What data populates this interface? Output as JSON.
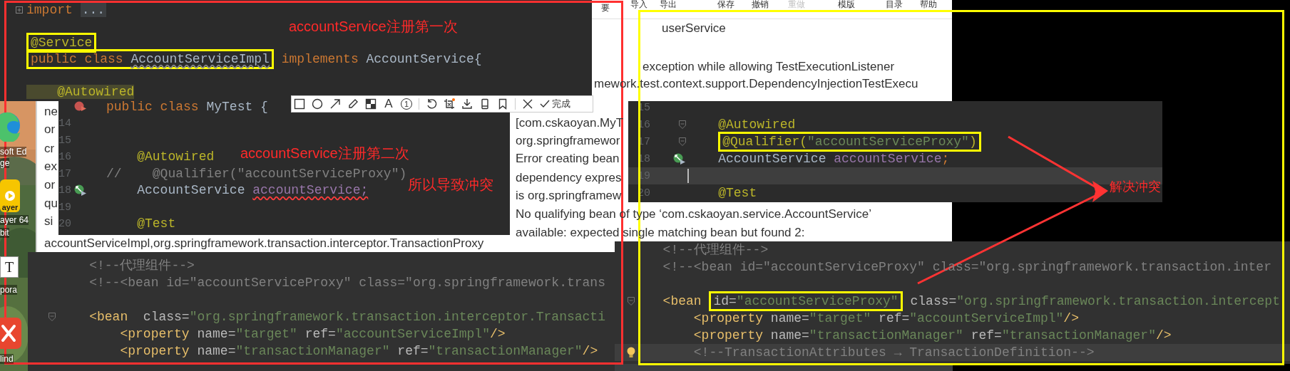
{
  "desktop": {
    "icons": [
      {
        "kind": "edge",
        "labels": [
          "soft Ed",
          "ge"
        ]
      },
      {
        "kind": "player",
        "badge": "ayer",
        "labels": [
          "ayer 64",
          "bit"
        ]
      },
      {
        "kind": "typora",
        "badge": "T",
        "labels": [
          "pora"
        ]
      },
      {
        "kind": "xmind",
        "labels": [
          "lind"
        ]
      }
    ]
  },
  "document": {
    "menu": [
      {
        "label": "要",
        "disabled": false
      },
      {
        "label": "导入",
        "disabled": false
      },
      {
        "label": "导出",
        "disabled": false
      },
      {
        "label": "保存",
        "disabled": false
      },
      {
        "label": "撤销",
        "disabled": false
      },
      {
        "label": "重做",
        "disabled": true
      },
      {
        "label": "模版",
        "disabled": false
      },
      {
        "label": "目录",
        "disabled": false
      },
      {
        "label": "帮助",
        "disabled": false
      }
    ],
    "texts": [
      "userService",
      "exception while allowing TestExecutionListener",
      "mework.test.context.support.DependencyInjectionTestExecu",
      "[com.cskaoyan.MyT",
      "org.springframewor",
      "Error creating bean",
      "dependency expres",
      "is org.springframew",
      "No qualifying bean of type ‘com.cskaoyan.service.AccountService’",
      "available: expected single matching bean but found 2:",
      "ne",
      "or",
      "cr",
      "ex",
      "or",
      "qu",
      "si",
      "accountServiceImpl,org.springframework.transaction.interceptor.TransactionProxy"
    ]
  },
  "toolbar": {
    "text_tool": "A",
    "number_tool": "1",
    "done": "完成"
  },
  "editors": [
    {
      "kind": "java",
      "lines": [
        {
          "kind": "code",
          "gutter": {
            "kind": "fold_plus"
          },
          "segments": [
            {
              "kind": "keyword",
              "text": "import ",
              "boxed": false
            },
            {
              "kind": "folded",
              "text": "...",
              "boxed": false
            }
          ]
        },
        {
          "kind": "blank"
        },
        {
          "kind": "code",
          "segments": [
            {
              "kind": "annotation",
              "text": "@Service",
              "boxed": true
            }
          ]
        },
        {
          "kind": "code",
          "segments": [
            {
              "kind": "keyword",
              "text": "public class ",
              "boxed": true
            },
            {
              "kind": "unused",
              "text": "AccountServiceImpl",
              "boxed": true
            },
            {
              "kind": "keyword",
              "text": " implements ",
              "boxed": false
            },
            {
              "kind": "plain",
              "text": "AccountService{",
              "boxed": false
            }
          ]
        },
        {
          "kind": "blank"
        },
        {
          "kind": "code",
          "segments": [
            {
              "kind": "annotation_usage",
              "text": "    @Autowired",
              "boxed": false
            }
          ]
        }
      ]
    },
    {
      "kind": "java",
      "lines": [
        {
          "kind": "code",
          "gutter": {
            "kind": "run_red"
          },
          "segments": [
            {
              "kind": "keyword",
              "text": "public class ",
              "boxed": false
            },
            {
              "kind": "plain",
              "text": "MyTest {",
              "boxed": false
            }
          ]
        },
        {
          "kind": "blank",
          "number": "14"
        },
        {
          "kind": "blank",
          "number": "15"
        },
        {
          "kind": "code",
          "number": "16",
          "segments": [
            {
              "kind": "annotation",
              "text": "    @Autowired",
              "boxed": false
            }
          ]
        },
        {
          "kind": "code",
          "number": "17",
          "segments": [
            {
              "kind": "comment",
              "text": "//    @Qualifier(\"accountServiceProxy\")",
              "boxed": false
            }
          ]
        },
        {
          "kind": "code",
          "number": "18",
          "gutter": {
            "kind": "run"
          },
          "segments": [
            {
              "kind": "plain",
              "text": "    AccountService ",
              "boxed": false
            },
            {
              "kind": "field_error",
              "text": "accountService;",
              "boxed": false
            }
          ]
        },
        {
          "kind": "blank",
          "number": "19"
        },
        {
          "kind": "code",
          "number": "20",
          "segments": [
            {
              "kind": "annotation",
              "text": "    @Test",
              "boxed": false
            }
          ]
        }
      ]
    },
    {
      "kind": "java",
      "lines": [
        {
          "kind": "blank",
          "number": "15",
          "current": false
        },
        {
          "kind": "code",
          "number": "16",
          "gutter": {
            "kind": "fold"
          },
          "current": false,
          "segments": [
            {
              "kind": "annotation",
              "text": "    @Autowired",
              "boxed": false
            }
          ]
        },
        {
          "kind": "code",
          "number": "17",
          "gutter": {
            "kind": "fold"
          },
          "current": false,
          "segments": [
            {
              "kind": "annotation",
              "text": "    @Qualifier(",
              "boxed": true
            },
            {
              "kind": "string",
              "text": "\"accountServiceProxy\"",
              "boxed": true
            },
            {
              "kind": "annotation",
              "text": ")",
              "boxed": true
            }
          ]
        },
        {
          "kind": "code",
          "number": "18",
          "gutter": {
            "kind": "run"
          },
          "current": false,
          "segments": [
            {
              "kind": "plain",
              "text": "    AccountService ",
              "boxed": false
            },
            {
              "kind": "field",
              "text": "accountService",
              "boxed": false
            },
            {
              "kind": "keyword",
              "text": ";",
              "boxed": false
            }
          ]
        },
        {
          "kind": "blank",
          "number": "19",
          "current": true
        },
        {
          "kind": "code",
          "number": "20",
          "current": false,
          "segments": [
            {
              "kind": "annotation",
              "text": "    @Test",
              "boxed": false
            }
          ]
        }
      ]
    },
    {
      "kind": "xml",
      "lines": [
        {
          "kind": "code",
          "segments": [
            {
              "kind": "comment",
              "text": "    <!--代理组件-->",
              "boxed": false
            }
          ]
        },
        {
          "kind": "code",
          "segments": [
            {
              "kind": "comment",
              "text": "    <!--<bean id=\"accountServiceProxy\" class=\"org.springframework.trans",
              "boxed": false
            }
          ]
        },
        {
          "kind": "blank"
        },
        {
          "kind": "code",
          "gutter": {
            "kind": "fold"
          },
          "segments": [
            {
              "kind": "tag",
              "text": "    <bean",
              "boxed": false
            },
            {
              "kind": "attr",
              "text": "  class=",
              "boxed": false
            },
            {
              "kind": "string",
              "text": "\"org.springframework.transaction.interceptor.Transacti",
              "boxed": false
            }
          ]
        },
        {
          "kind": "code",
          "segments": [
            {
              "kind": "tag",
              "text": "        <property",
              "boxed": false
            },
            {
              "kind": "attr",
              "text": " name=",
              "boxed": false
            },
            {
              "kind": "string",
              "text": "\"target\"",
              "boxed": false
            },
            {
              "kind": "attr",
              "text": " ref=",
              "boxed": false
            },
            {
              "kind": "string",
              "text": "\"accountServiceImpl\"",
              "boxed": false
            },
            {
              "kind": "tag",
              "text": "/>",
              "boxed": false
            }
          ]
        },
        {
          "kind": "code",
          "segments": [
            {
              "kind": "tag",
              "text": "        <property",
              "boxed": false
            },
            {
              "kind": "attr",
              "text": " name=",
              "boxed": false
            },
            {
              "kind": "string",
              "text": "\"transactionManager\"",
              "boxed": false
            },
            {
              "kind": "attr",
              "text": " ref=",
              "boxed": false
            },
            {
              "kind": "string",
              "text": "\"transactionManager\"",
              "boxed": false
            },
            {
              "kind": "tag",
              "text": "/>",
              "boxed": false
            }
          ]
        }
      ]
    },
    {
      "kind": "xml",
      "lines": [
        {
          "kind": "code",
          "current": false,
          "segments": [
            {
              "kind": "comment",
              "text": "  <!--代理组件-->",
              "boxed": false
            }
          ]
        },
        {
          "kind": "code",
          "current": false,
          "segments": [
            {
              "kind": "comment",
              "text": "  <!--<bean id=\"accountServiceProxy\" class=\"org.springframework.transaction.inter",
              "boxed": false
            }
          ]
        },
        {
          "kind": "blank",
          "current": false
        },
        {
          "kind": "code",
          "gutter": {
            "kind": "fold"
          },
          "current": false,
          "segments": [
            {
              "kind": "tag",
              "text": "  <bean ",
              "boxed": false
            },
            {
              "kind": "attr",
              "text": "id=",
              "boxed": true
            },
            {
              "kind": "string",
              "text": "\"accountServiceProxy\"",
              "boxed": true
            },
            {
              "kind": "attr",
              "text": " class=",
              "boxed": false
            },
            {
              "kind": "string",
              "text": "\"org.springframework.transaction.intercept",
              "boxed": false
            }
          ]
        },
        {
          "kind": "code",
          "current": false,
          "segments": [
            {
              "kind": "tag",
              "text": "      <property",
              "boxed": false
            },
            {
              "kind": "attr",
              "text": " name=",
              "boxed": false
            },
            {
              "kind": "string",
              "text": "\"target\"",
              "boxed": false
            },
            {
              "kind": "attr",
              "text": " ref=",
              "boxed": false
            },
            {
              "kind": "string",
              "text": "\"accountServiceImpl\"",
              "boxed": false
            },
            {
              "kind": "tag",
              "text": "/>",
              "boxed": false
            }
          ]
        },
        {
          "kind": "code",
          "current": false,
          "segments": [
            {
              "kind": "tag",
              "text": "      <property",
              "boxed": false
            },
            {
              "kind": "attr",
              "text": " name=",
              "boxed": false
            },
            {
              "kind": "string",
              "text": "\"transactionManager\"",
              "boxed": false
            },
            {
              "kind": "attr",
              "text": " ref=",
              "boxed": false
            },
            {
              "kind": "string",
              "text": "\"transactionManager\"",
              "boxed": false
            },
            {
              "kind": "tag",
              "text": "/>",
              "boxed": false
            }
          ]
        },
        {
          "kind": "code",
          "gutter": {
            "kind": "bulb"
          },
          "current": true,
          "segments": [
            {
              "kind": "comment",
              "text": "      <!--TransactionAttributes → TransactionDefinition-->",
              "boxed": false
            }
          ]
        }
      ]
    }
  ],
  "annotations": [
    "accountService注册第一次",
    "accountService注册第二次",
    "所以导致冲突",
    "解决冲突"
  ]
}
